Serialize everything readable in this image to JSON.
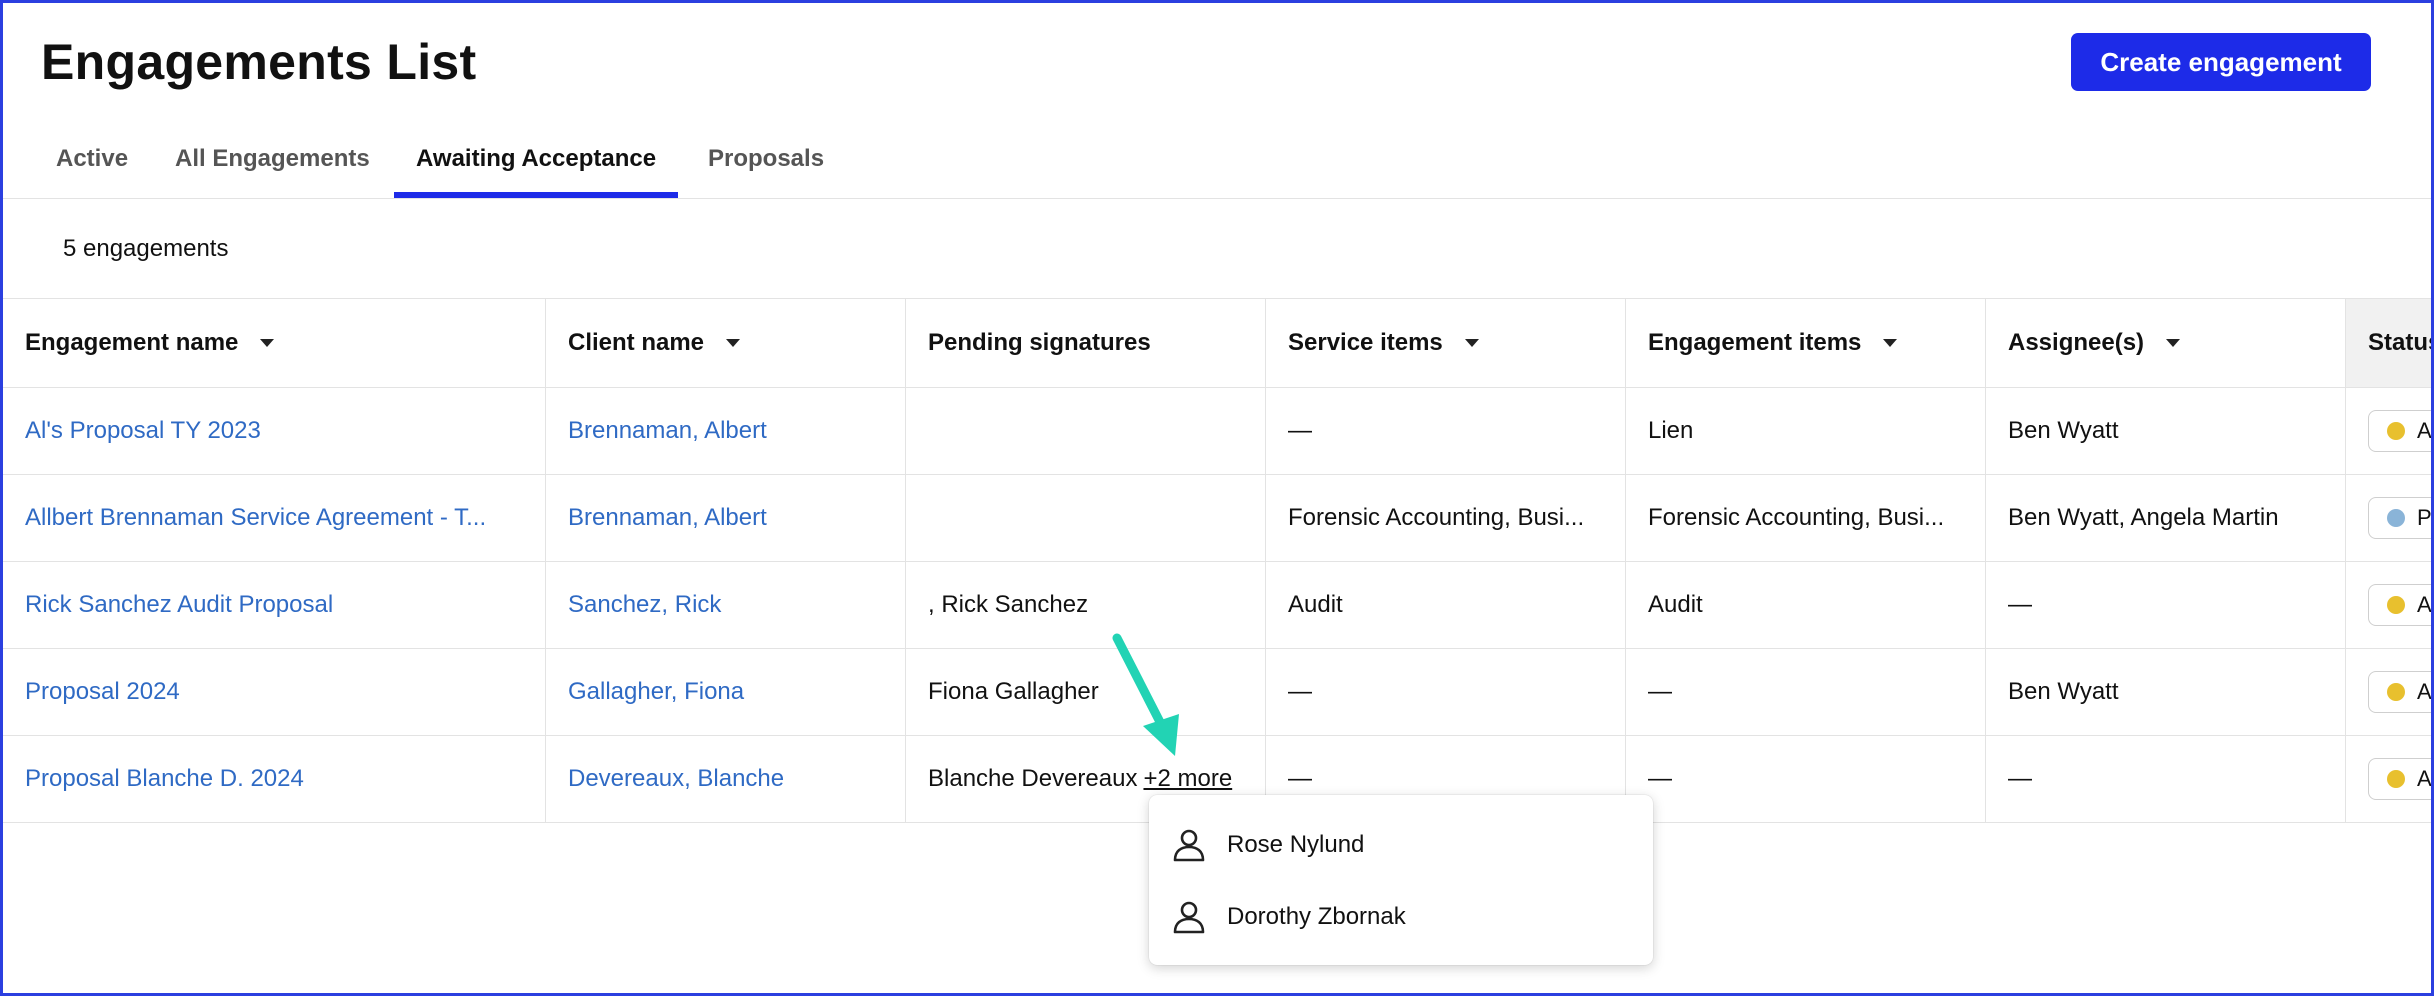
{
  "header": {
    "title": "Engagements List",
    "create_button": "Create engagement"
  },
  "tabs": [
    {
      "label": "Active",
      "active": false
    },
    {
      "label": "All Engagements",
      "active": false
    },
    {
      "label": "Awaiting Acceptance",
      "active": true
    },
    {
      "label": "Proposals",
      "active": false
    }
  ],
  "summary": {
    "count": "5 engagements"
  },
  "table": {
    "columns": [
      {
        "label": "Engagement name",
        "sortable": true
      },
      {
        "label": "Client name",
        "sortable": true
      },
      {
        "label": "Pending signatures",
        "sortable": false
      },
      {
        "label": "Service items",
        "sortable": true
      },
      {
        "label": "Engagement items",
        "sortable": true
      },
      {
        "label": "Assignee(s)",
        "sortable": true
      },
      {
        "label": "Status",
        "sortable": false
      }
    ],
    "rows": [
      {
        "engagement": "Al's Proposal TY 2023",
        "client": "Brennaman, Albert",
        "pending": "",
        "service": "—",
        "items": "Lien",
        "assignees": "Ben Wyatt",
        "status_color": "#e8c02e",
        "status_label": "A"
      },
      {
        "engagement": "Allbert Brennaman Service Agreement - T...",
        "client": "Brennaman, Albert",
        "pending": "",
        "service": "Forensic Accounting, Busi...",
        "items": "Forensic Accounting, Busi...",
        "assignees": "Ben Wyatt, Angela Martin",
        "status_color": "#8ab4d8",
        "status_label": "P"
      },
      {
        "engagement": "Rick Sanchez Audit Proposal",
        "client": "Sanchez, Rick",
        "pending": ", Rick Sanchez",
        "service": "Audit",
        "items": "Audit",
        "assignees": "—",
        "status_color": "#e8c02e",
        "status_label": "A"
      },
      {
        "engagement": "Proposal 2024",
        "client": "Gallagher, Fiona",
        "pending": "Fiona Gallagher",
        "service": "—",
        "items": "—",
        "assignees": "Ben Wyatt",
        "status_color": "#e8c02e",
        "status_label": "A"
      },
      {
        "engagement": "Proposal Blanche D. 2024",
        "client": "Devereaux, Blanche",
        "pending": "Blanche Devereaux",
        "pending_more": "+2 more",
        "service": "—",
        "items": "—",
        "assignees": "—",
        "status_color": "#e8c02e",
        "status_label": "A"
      }
    ]
  },
  "popover": {
    "people": [
      "Rose Nylund",
      "Dorothy Zbornak"
    ],
    "icon": "person-icon"
  },
  "colors": {
    "accent": "#1d2be8",
    "link": "#2f6ac4",
    "annotation_arrow": "#22d3b4"
  }
}
